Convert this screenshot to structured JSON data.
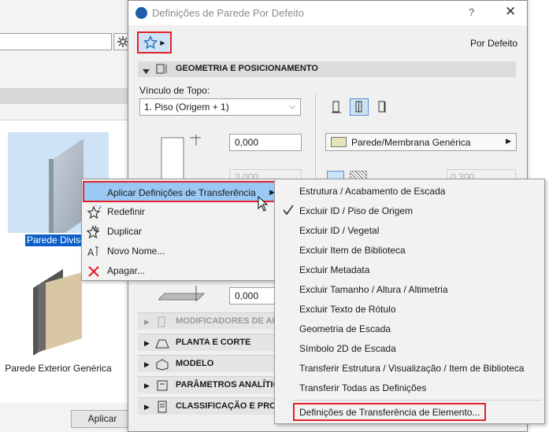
{
  "library_panel": {
    "selected_item_label": "Parede Diviso",
    "item2_label": "Parede Exterior Genérica",
    "apply_button": "Aplicar"
  },
  "dialog": {
    "title": "Definições de Parede Por Defeito",
    "help": "?",
    "close": "✕",
    "preset_name": "Por Defeito",
    "geometry_section": "GEOMETRIA E POSICIONAMENTO",
    "top_link_label": "Vínculo de Topo:",
    "top_link_value": "1. Piso (Origem + 1)",
    "top_offset": "0,000",
    "height_value": "3,000",
    "bottom_offset": "0,000",
    "material": "Parede/Membrana Genérica",
    "thickness_value": "0,300",
    "sections": [
      {
        "label": "MODIFICADORES DE AFA",
        "disabled": true
      },
      {
        "label": "PLANTA E CORTE",
        "disabled": false
      },
      {
        "label": "MODELO",
        "disabled": false
      },
      {
        "label": "PARÂMETROS ANALÍTIC",
        "disabled": false
      },
      {
        "label": "CLASSIFICAÇÃO E PROPI",
        "disabled": false
      }
    ]
  },
  "context_menu": {
    "items": [
      "Aplicar Definições de Transferência",
      "Redefinir",
      "Duplicar",
      "Novo Nome...",
      "Apagar..."
    ]
  },
  "submenu": {
    "items": [
      "Estrutura / Acabamento de Escada",
      "Excluir ID / Piso de Origem",
      "Excluir ID / Vegetal",
      "Excluir Item de Biblioteca",
      "Excluir Metadata",
      "Excluir Tamanho / Altura / Altimetria",
      "Excluir Texto de Rótulo",
      "Geometria de Escada",
      "Símbolo 2D de Escada",
      "Transferir Estrutura / Visualização / Item de Biblioteca",
      "Transferir Todas as Definições"
    ],
    "custom_item": "Definições de Transferência de Elemento...",
    "checked_index": 1
  },
  "colors": {
    "highlight_red": "#e3222a",
    "selection_blue": "#99c8f4",
    "accent_blue": "#0a5fc8"
  }
}
